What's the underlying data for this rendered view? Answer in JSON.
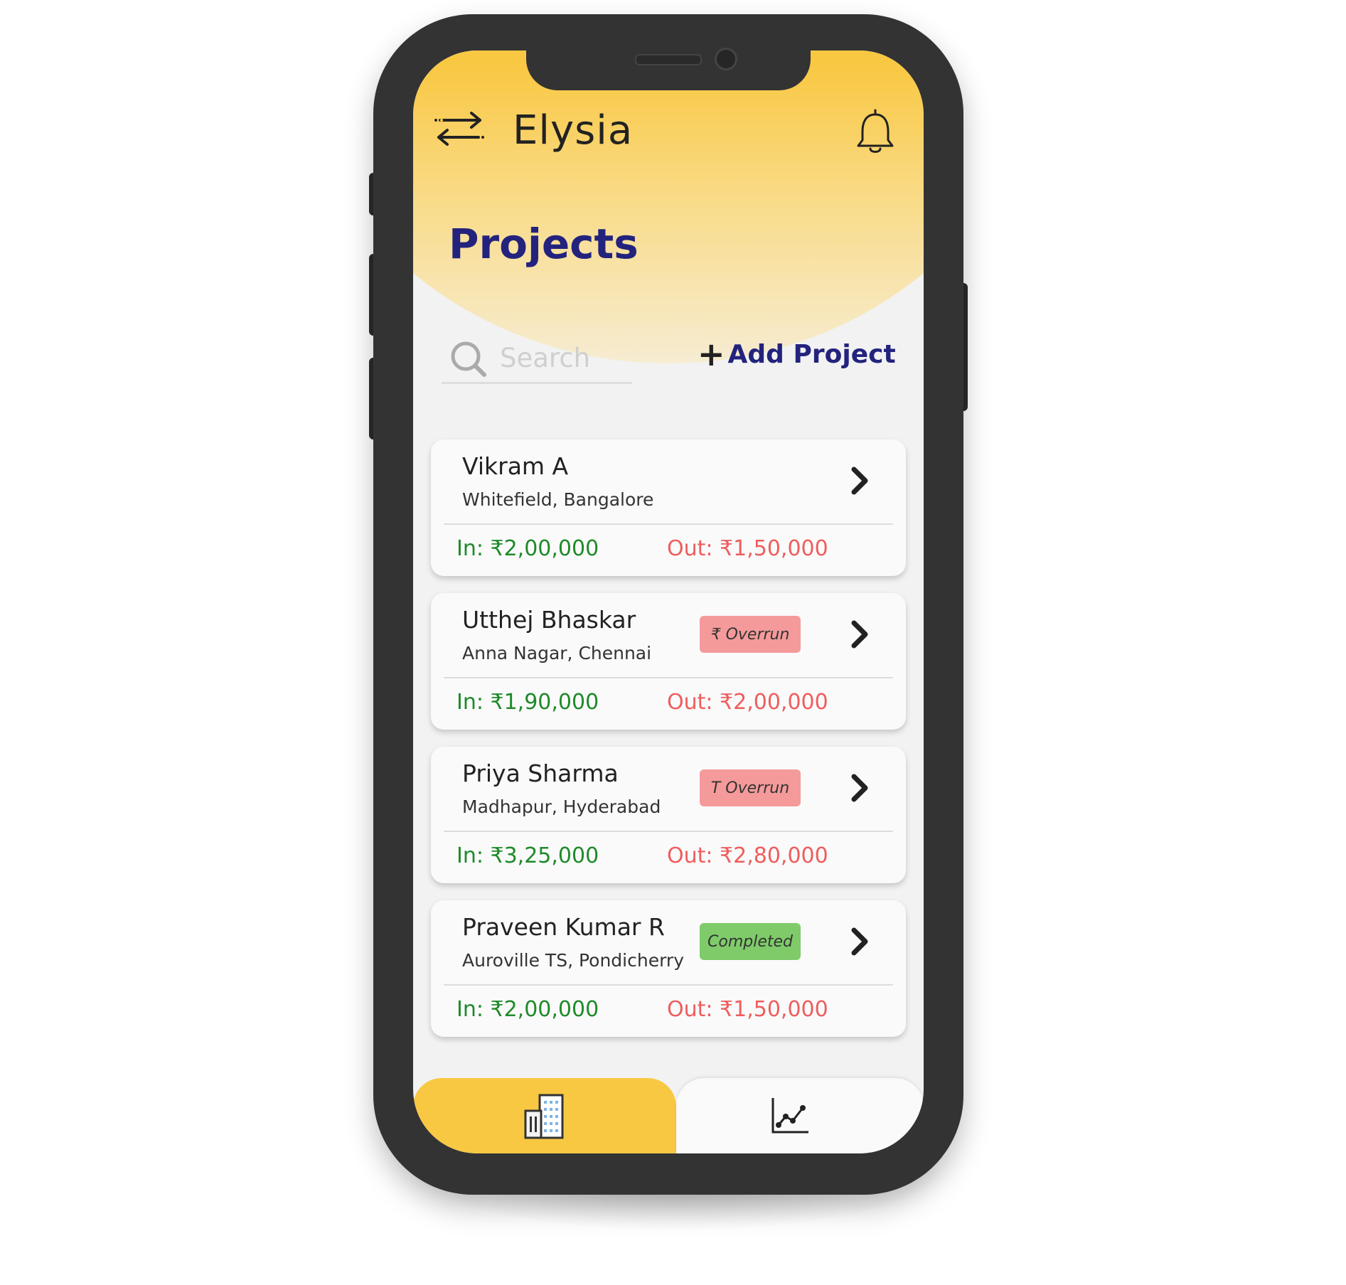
{
  "app": {
    "title": "Elysia"
  },
  "page": {
    "title": "Projects"
  },
  "search": {
    "placeholder": "Search",
    "value": ""
  },
  "actions": {
    "add_project_plus": "+",
    "add_project_label": "Add Project"
  },
  "projects": [
    {
      "name": "Vikram A",
      "location": "Whitefield, Bangalore",
      "badge": "",
      "in_text": "In: ₹2,00,000",
      "out_text": "Out: ₹1,50,000"
    },
    {
      "name": "Utthej Bhaskar",
      "location": "Anna Nagar, Chennai",
      "badge": "₹ Overrun",
      "in_text": "In: ₹1,90,000",
      "out_text": "Out: ₹2,00,000"
    },
    {
      "name": "Priya Sharma",
      "location": "Madhapur, Hyderabad",
      "badge": "T Overrun",
      "in_text": "In: ₹3,25,000",
      "out_text": "Out: ₹2,80,000"
    },
    {
      "name": "Praveen Kumar R",
      "location": "Auroville TS, Pondicherry",
      "badge": "Completed",
      "in_text": "In: ₹2,00,000",
      "out_text": "Out: ₹1,50,000"
    }
  ],
  "colors": {
    "header_yellow": "#f9c843",
    "title_navy": "#23237e",
    "in_green": "#1e8a2a",
    "out_red": "#ef5d5d",
    "badge_overrun": "#f59a9a",
    "badge_completed": "#7fcb6a"
  },
  "icons": {
    "menu": "swap-arrows-icon",
    "notifications": "bell-icon",
    "search": "search-icon",
    "row_action": "chevron-right-icon",
    "tab_projects": "building-icon",
    "tab_analytics": "chart-icon"
  }
}
